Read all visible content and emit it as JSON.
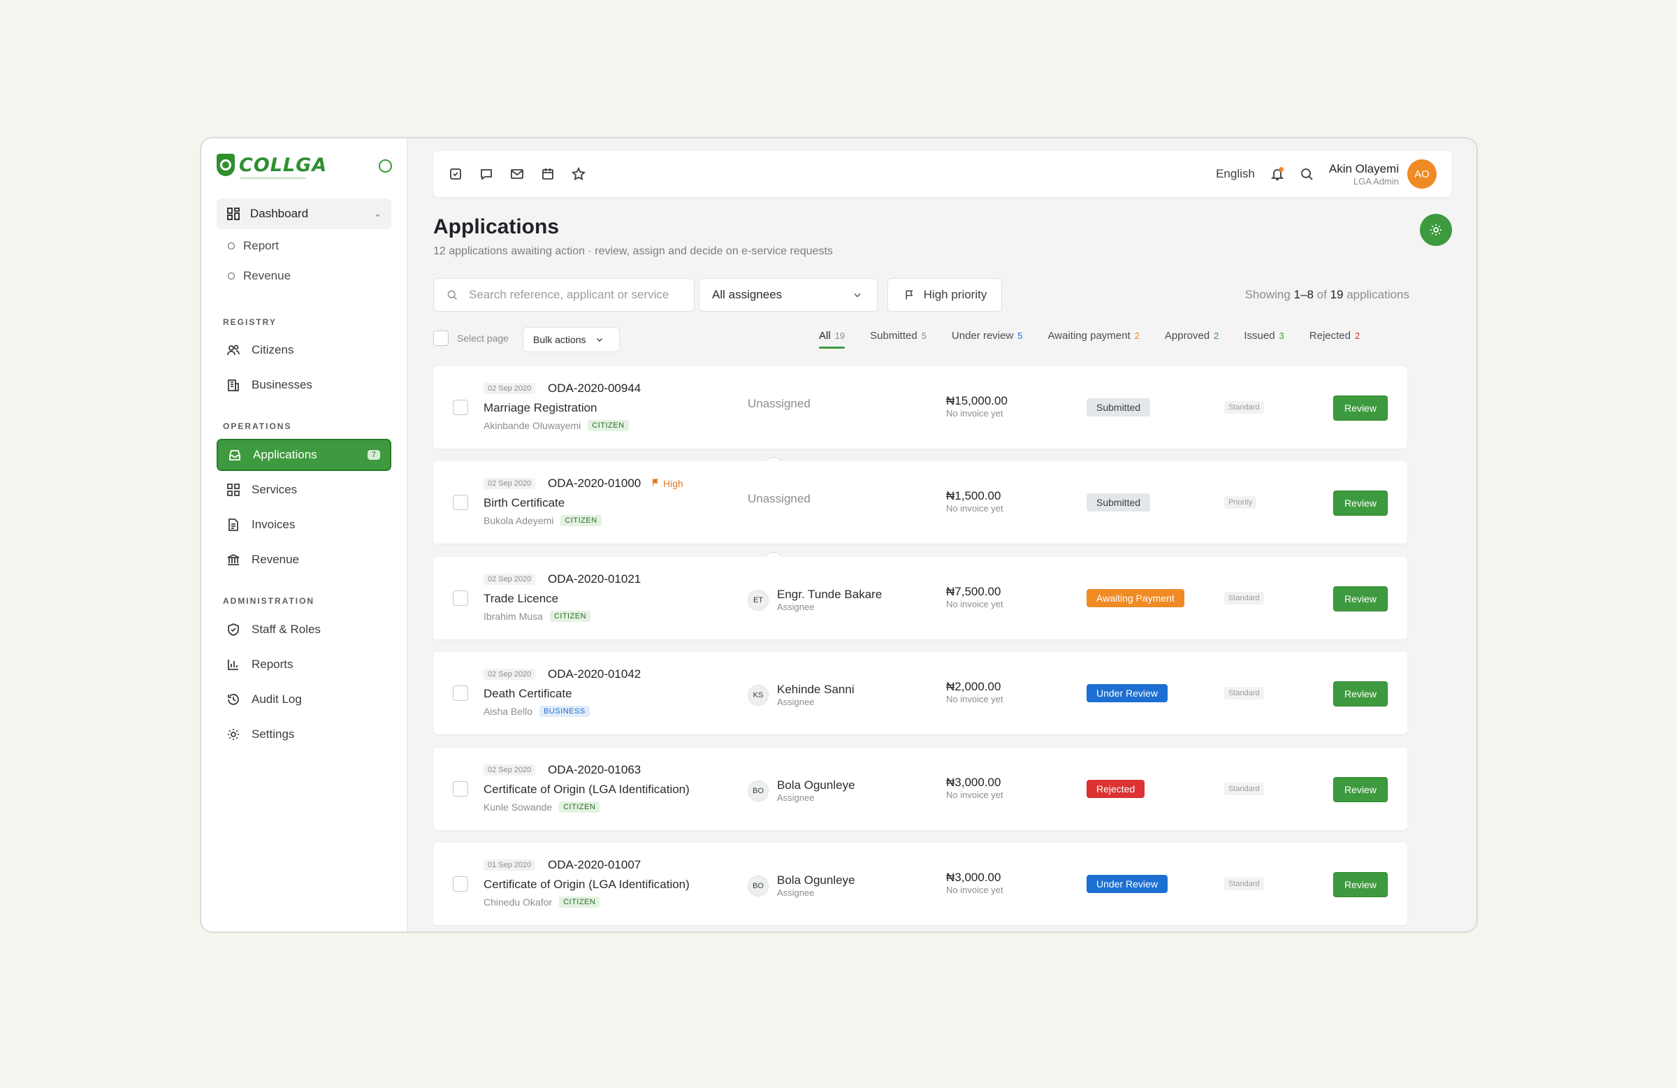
{
  "brand": {
    "name": "COLLGA"
  },
  "sidebar": {
    "dashboard": "Dashboard",
    "dashboard_sub": [
      "Report",
      "Revenue"
    ],
    "sections": {
      "registry": "REGISTRY",
      "operations": "OPERATIONS",
      "administration": "ADMINISTRATION"
    },
    "registry": [
      "Citizens",
      "Businesses"
    ],
    "operations": [
      {
        "label": "Applications",
        "badge": "7"
      },
      {
        "label": "Services"
      },
      {
        "label": "Invoices"
      },
      {
        "label": "Revenue"
      }
    ],
    "administration": [
      "Staff & Roles",
      "Reports",
      "Audit Log",
      "Settings"
    ]
  },
  "topbar": {
    "language": "English",
    "user_name": "Akin Olayemi",
    "user_role": "LGA Admin",
    "user_initials": "AO"
  },
  "page": {
    "title": "Applications",
    "subtitle": "12 applications awaiting action · review, assign and decide on e-service requests"
  },
  "filters": {
    "search_placeholder": "Search reference, applicant or service",
    "assignees": "All assignees",
    "priority": "High priority",
    "showing": {
      "prefix": "Showing",
      "range": "1–8",
      "of": "of",
      "total": "19",
      "suffix": "applications"
    }
  },
  "toolbar": {
    "select_page": "Select page",
    "bulk_actions": "Bulk actions"
  },
  "tabs": [
    {
      "label": "All",
      "count": "19",
      "color": "#8a8d90"
    },
    {
      "label": "Submitted",
      "count": "5",
      "color": "#8a8d90"
    },
    {
      "label": "Under review",
      "count": "5",
      "color": "#1d6fd1"
    },
    {
      "label": "Awaiting payment",
      "count": "2",
      "color": "#f08a24"
    },
    {
      "label": "Approved",
      "count": "2",
      "color": "#3e9a3e"
    },
    {
      "label": "Issued",
      "count": "3",
      "color": "#3e9a3e"
    },
    {
      "label": "Rejected",
      "count": "2",
      "color": "#dc3232"
    }
  ],
  "applications": [
    {
      "date": "02 Sep 2020",
      "ref": "ODA-2020-00944",
      "high": "",
      "service": "Marriage Registration",
      "applicant": "Akinbande Oluwayemi",
      "type": "CITIZEN",
      "assignee": "Unassigned",
      "assignee_initials": "",
      "assignee_sub": "",
      "amount": "₦15,000.00",
      "invoice": "No invoice yet",
      "status": "Submitted",
      "status_kind": "submitted",
      "priority": "Standard",
      "action": "Review"
    },
    {
      "date": "02 Sep 2020",
      "ref": "ODA-2020-01000",
      "high": "High",
      "service": "Birth Certificate",
      "applicant": "Bukola Adeyemi",
      "type": "CITIZEN",
      "assignee": "Unassigned",
      "assignee_initials": "",
      "assignee_sub": "",
      "amount": "₦1,500.00",
      "invoice": "No invoice yet",
      "status": "Submitted",
      "status_kind": "submitted",
      "priority": "Priority",
      "action": "Review"
    },
    {
      "date": "02 Sep 2020",
      "ref": "ODA-2020-01021",
      "high": "",
      "service": "Trade Licence",
      "applicant": "Ibrahim Musa",
      "type": "CITIZEN",
      "assignee": "Engr. Tunde Bakare",
      "assignee_initials": "ET",
      "assignee_sub": "Assignee",
      "amount": "₦7,500.00",
      "invoice": "No invoice yet",
      "status": "Awaiting Payment",
      "status_kind": "awaiting",
      "priority": "Standard",
      "action": "Review"
    },
    {
      "date": "02 Sep 2020",
      "ref": "ODA-2020-01042",
      "high": "",
      "service": "Death Certificate",
      "applicant": "Aisha Bello",
      "type": "BUSINESS",
      "assignee": "Kehinde Sanni",
      "assignee_initials": "KS",
      "assignee_sub": "Assignee",
      "amount": "₦2,000.00",
      "invoice": "No invoice yet",
      "status": "Under Review",
      "status_kind": "review",
      "priority": "Standard",
      "action": "Review"
    },
    {
      "date": "02 Sep 2020",
      "ref": "ODA-2020-01063",
      "high": "",
      "service": "Certificate of Origin (LGA Identification)",
      "applicant": "Kunle Sowande",
      "type": "CITIZEN",
      "assignee": "Bola Ogunleye",
      "assignee_initials": "BO",
      "assignee_sub": "Assignee",
      "amount": "₦3,000.00",
      "invoice": "No invoice yet",
      "status": "Rejected",
      "status_kind": "rejected",
      "priority": "Standard",
      "action": "Review"
    },
    {
      "date": "01 Sep 2020",
      "ref": "ODA-2020-01007",
      "high": "",
      "service": "Certificate of Origin (LGA Identification)",
      "applicant": "Chinedu Okafor",
      "type": "CITIZEN",
      "assignee": "Bola Ogunleye",
      "assignee_initials": "BO",
      "assignee_sub": "Assignee",
      "amount": "₦3,000.00",
      "invoice": "No invoice yet",
      "status": "Under Review",
      "status_kind": "review",
      "priority": "Standard",
      "action": "Review"
    }
  ],
  "colors": {
    "brand": "#3e9a3e",
    "accent": "#f08a24",
    "info": "#1d6fd1",
    "danger": "#dc3232"
  }
}
